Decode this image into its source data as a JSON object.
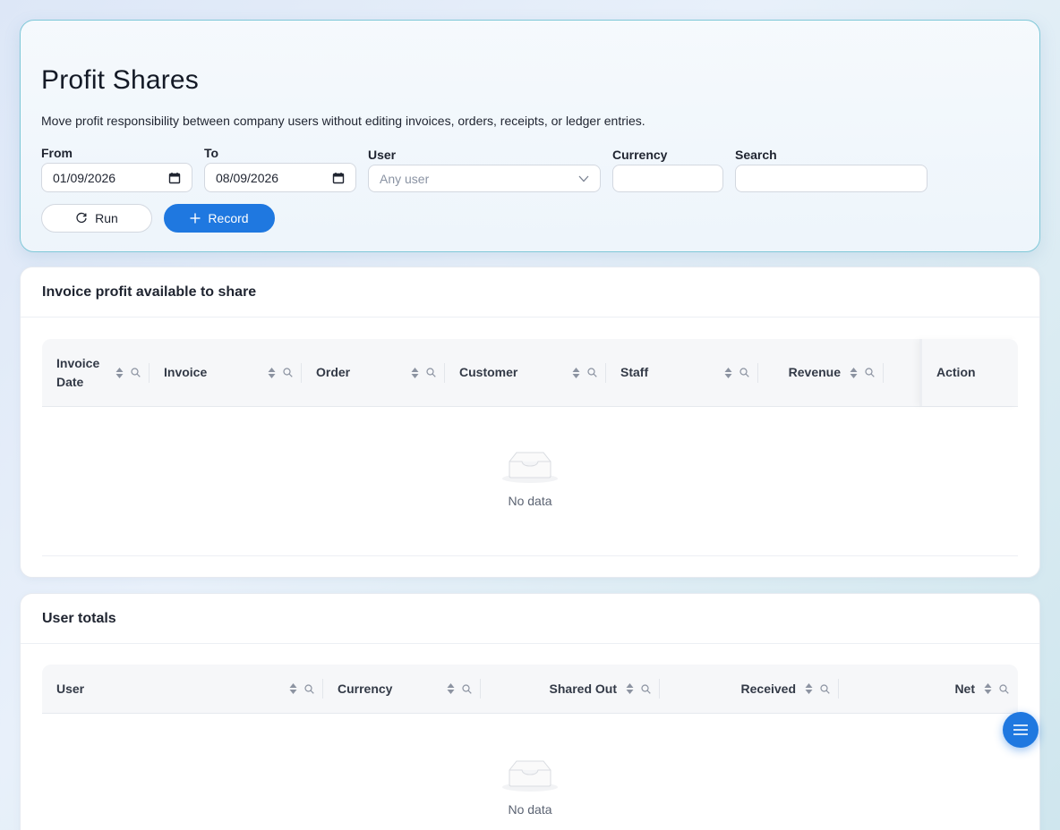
{
  "header": {
    "title": "Profit Shares",
    "subtitle": "Move profit responsibility between company users without editing invoices, orders, receipts, or ledger entries."
  },
  "filters": {
    "from_label": "From",
    "from_value": "01/09/2026",
    "to_label": "To",
    "to_value": "08/09/2026",
    "user_label": "User",
    "user_placeholder": "Any user",
    "currency_label": "Currency",
    "currency_value": "",
    "search_label": "Search",
    "search_value": ""
  },
  "actions": {
    "run_label": "Run",
    "record_label": "Record"
  },
  "invoice_table": {
    "title": "Invoice profit available to share",
    "columns": [
      "Invoice Date",
      "Invoice",
      "Order",
      "Customer",
      "Staff",
      "Revenue",
      "Action"
    ],
    "empty_text": "No data"
  },
  "user_totals": {
    "title": "User totals",
    "columns": [
      "User",
      "Currency",
      "Shared Out",
      "Received",
      "Net"
    ],
    "empty_text": "No data"
  },
  "colors": {
    "accent": "#1f78e0",
    "hero_border": "#7fc8d8"
  }
}
